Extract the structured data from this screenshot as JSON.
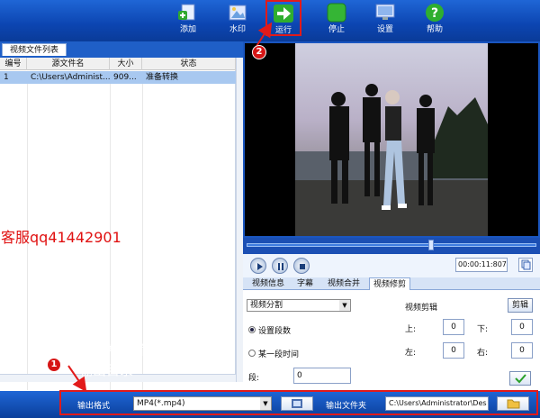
{
  "toolbar": {
    "items": [
      {
        "label": "添加"
      },
      {
        "label": "水印"
      },
      {
        "label": "运行"
      },
      {
        "label": "停止"
      },
      {
        "label": "设置"
      },
      {
        "label": "帮助"
      }
    ]
  },
  "file_list": {
    "tab": "视频文件列表",
    "columns": [
      "编号",
      "源文件名",
      "大小",
      "状态"
    ],
    "rows": [
      {
        "index": "1",
        "name": "C:\\Users\\Administ...",
        "size": "909...",
        "status": "准备转换"
      }
    ]
  },
  "watermark_text": "客服qq41442901",
  "player": {
    "time": "00:00:11:807",
    "seek_fraction": 0.64
  },
  "edit_tabs": [
    "视频信息",
    "字幕",
    "视频合并",
    "视频修剪"
  ],
  "edit_panel": {
    "mode_select": "视频分割",
    "radio_set_segments": "设置段数",
    "radio_time": "某一段时间",
    "segments_label": "段:",
    "segments_value": "0",
    "crop_title": "视频剪辑",
    "crop_button": "剪辑",
    "top_label": "上:",
    "top_value": "0",
    "bottom_label": "下:",
    "bottom_value": "0",
    "left_label": "左:",
    "left_value": "0",
    "right_label": "右:",
    "right_value": "0"
  },
  "bottom_bar": {
    "format_label": "输出格式",
    "format_value": "MP4(*.mp4)",
    "folder_label": "输出文件夹",
    "folder_value": "C:\\Users\\Administrator\\Des"
  },
  "annotations": {
    "badge1": "1",
    "badge2": "2",
    "note_line1": "设置视频输出格式、",
    "note_line2": "输出目录"
  },
  "colors": {
    "accent": "#0c45b1",
    "highlight": "#e21a1a",
    "selection": "#a8c8f0"
  }
}
